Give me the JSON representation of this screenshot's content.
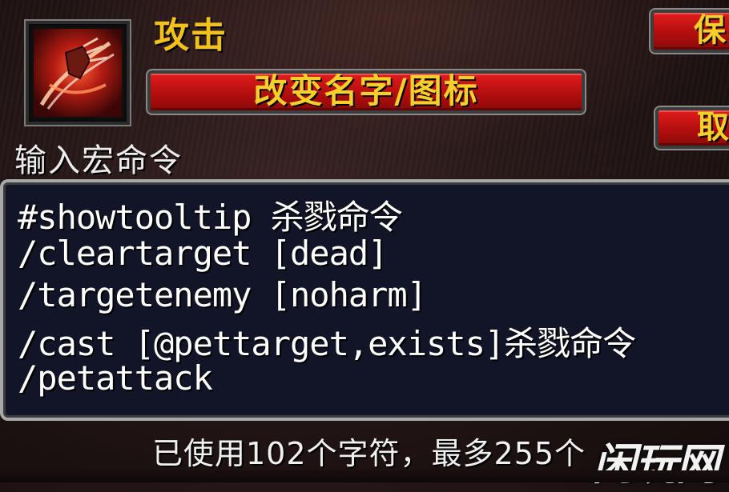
{
  "macro": {
    "name": "攻击",
    "icon": "claw-strike-icon",
    "label": "输入宏命令",
    "lines": [
      "#showtooltip 杀戮命令",
      "/cleartarget [dead]",
      "/targetenemy [noharm]",
      "/cast [@pettarget,exists]杀戮命令",
      "/petattack"
    ],
    "char_count": "已使用102个字符，最多255个"
  },
  "buttons": {
    "rename": "改变名字/图标",
    "save": "保",
    "cancel": "取"
  },
  "watermark": "闲玩网",
  "colors": {
    "accent_gold": "#f3c21a",
    "button_red": "#c81414",
    "edit_bg": "#121527"
  }
}
